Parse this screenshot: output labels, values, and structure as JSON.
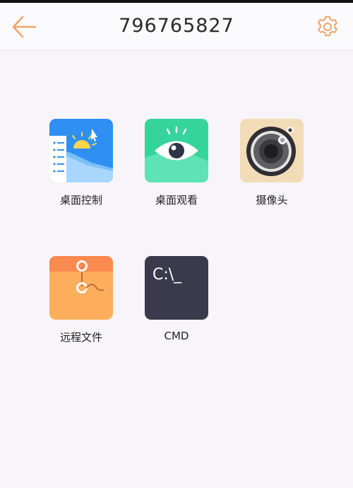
{
  "header": {
    "title": "796765827",
    "accent_color": "#f0a56b",
    "back_icon": "arrow-left-icon",
    "settings_icon": "gear-icon"
  },
  "apps": [
    {
      "label": "桌面控制",
      "icon": "desktop-control-icon"
    },
    {
      "label": "桌面观看",
      "icon": "eye-icon"
    },
    {
      "label": "摄像头",
      "icon": "camera-icon"
    },
    {
      "label": "远程文件",
      "icon": "folder-icon"
    },
    {
      "label": "CMD",
      "icon": "terminal-icon",
      "prompt": "C:\\_"
    }
  ],
  "colors": {
    "desktop_control": "#2f8ff3",
    "desktop_view": "#35d49b",
    "camera": "#f2dcb8",
    "files": "#fcae5c",
    "cmd": "#3a3a4c"
  }
}
